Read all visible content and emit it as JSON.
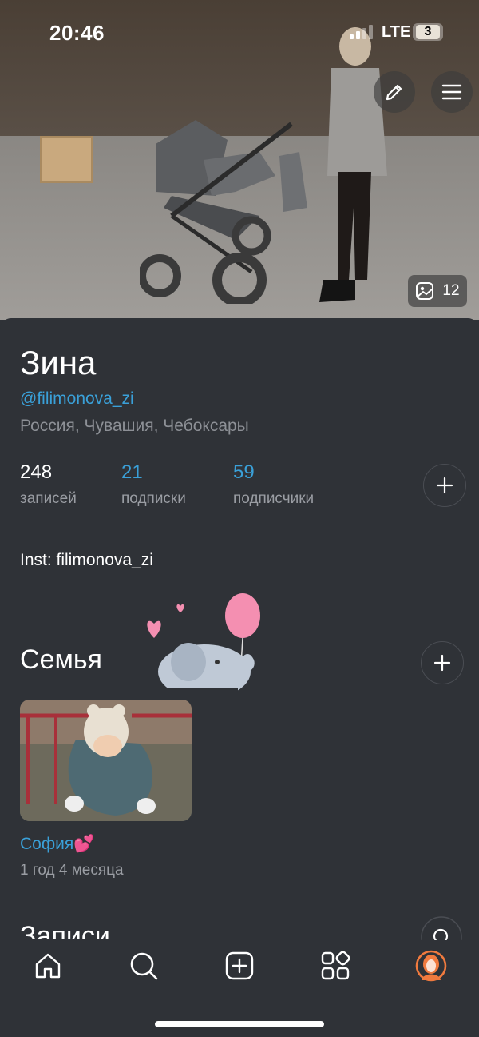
{
  "status_bar": {
    "time": "20:46",
    "network": "LTE",
    "battery": "3"
  },
  "cover": {
    "photo_count": "12"
  },
  "profile": {
    "name": "Зина",
    "handle": "@filimonova_zi",
    "location": "Россия, Чувашия, Чебоксары",
    "stats": [
      {
        "value": "248",
        "label": "записей"
      },
      {
        "value": "21",
        "label": "подписки"
      },
      {
        "value": "59",
        "label": "подписчики"
      }
    ],
    "bio": "Inst: filimonova_zi"
  },
  "family": {
    "title": "Семья",
    "members": [
      {
        "name": "София💕",
        "age": "1 год 4 месяца"
      }
    ]
  },
  "posts": {
    "title": "Записи"
  },
  "icons": {
    "edit": "pencil-icon",
    "menu": "menu-icon",
    "gallery": "image-icon",
    "add": "plus-icon",
    "nav": [
      "home-icon",
      "search-icon",
      "add-post-icon",
      "services-icon",
      "profile-avatar-icon"
    ]
  },
  "colors": {
    "accent": "#3aa0d8",
    "background": "#2f3237",
    "muted": "#9a9da3",
    "avatar": "#f07a3e"
  }
}
